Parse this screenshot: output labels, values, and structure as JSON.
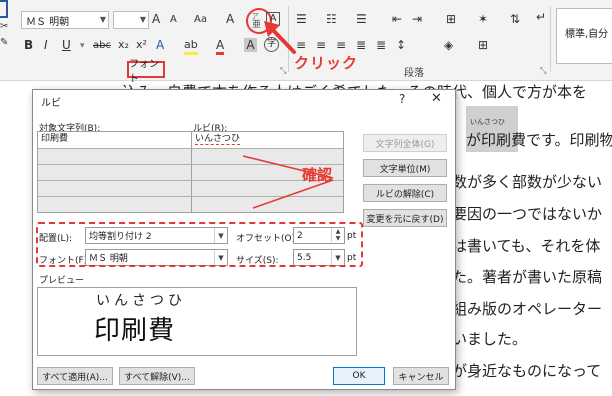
{
  "ribbon": {
    "font_name": "ＭＳ 明朝",
    "font_size": "",
    "font_group_label": "フォント",
    "paragraph_group_label": "段落",
    "style_label": "標準,自分",
    "annotation_click": "クリック",
    "buttons": {
      "bold": "B",
      "italic": "I",
      "underline": "U",
      "strike": "abc",
      "subscript": "x₂",
      "superscript": "x²",
      "grow": "A",
      "shrink": "A",
      "case": "Aa",
      "clear": "A",
      "ruby": "亜",
      "border": "A",
      "highlight": "ab",
      "fontcolor": "A",
      "charshade": "A",
      "enclose": "字"
    }
  },
  "dialog": {
    "title": "ルビ",
    "help": "?",
    "close": "✕",
    "base_text_label": "対象文字列(B):",
    "ruby_text_label": "ルビ(R):",
    "rows": [
      {
        "base": "印刷費",
        "ruby": "いんさつひ"
      },
      {
        "base": "",
        "ruby": ""
      },
      {
        "base": "",
        "ruby": ""
      },
      {
        "base": "",
        "ruby": ""
      },
      {
        "base": "",
        "ruby": ""
      }
    ],
    "annotation_confirm": "確認",
    "buttons": {
      "group_all": "文字列全体(G)",
      "mono": "文字単位(M)",
      "clear_ruby": "ルビの解除(C)",
      "default_reading": "変更を元に戻す(D)",
      "apply_all": "すべて適用(A)...",
      "remove_all": "すべて解除(V)...",
      "ok": "OK",
      "cancel": "キャンセル"
    },
    "alignment_label": "配置(L):",
    "alignment_value": "均等割り付け 2",
    "offset_label": "オフセット(O):",
    "offset_value": "2",
    "offset_unit": "pt",
    "font_label": "フォント(F):",
    "font_value": "ＭＳ 明朝",
    "size_label": "サイズ(S):",
    "size_value": "5.5",
    "size_unit": "pt",
    "preview_label": "プレビュー",
    "preview_ruby": "いんさつひ",
    "preview_base": "印刷費"
  },
  "document": {
    "lines": [
      "込み、自費で本を作る人はごく希でした。その時代、個人で方が本を",
      "が印刷費です。印刷物",
      "数が多く部数が少ない",
      "要因の一つではないか",
      "は書いても、それを体",
      "た。著者が書いた原稿",
      "組み版のオペレーター",
      "いました。",
      "が身近なものになって"
    ],
    "ruby_over": "いんさつひ"
  }
}
